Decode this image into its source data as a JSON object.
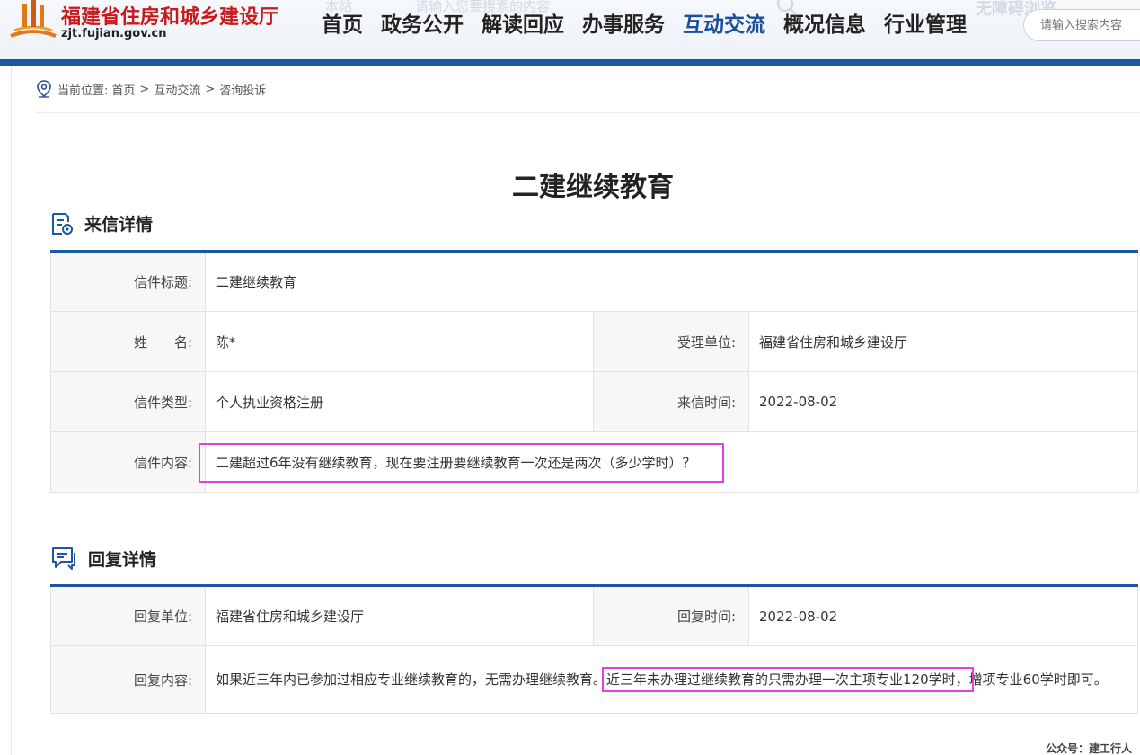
{
  "header": {
    "site_name": "福建省住房和城乡建设厅",
    "site_url": "zjt.fujian.gov.cn",
    "top_ghost_left": "本站",
    "top_ghost_placeholder": "请输入您要搜索的内容",
    "top_ghost_right": "无障碍浏览",
    "nav": [
      "首页",
      "政务公开",
      "解读回应",
      "办事服务",
      "互动交流",
      "概况信息",
      "行业管理"
    ],
    "active_nav": "互动交流",
    "search_placeholder": "请输入搜索内容"
  },
  "breadcrumb": {
    "prefix": "当前位置:",
    "items": [
      "首页",
      "互动交流",
      "咨询投诉"
    ],
    "separator": ">"
  },
  "page_title": "二建继续教育",
  "letter": {
    "heading": "来信详情",
    "title_label": "信件标题:",
    "title_value": "二建继续教育",
    "name_label": "姓　　名:",
    "name_value": "陈*",
    "dept_label": "受理单位:",
    "dept_value": "福建省住房和城乡建设厅",
    "type_label": "信件类型:",
    "type_value": "个人执业资格注册",
    "time_label": "来信时间:",
    "time_value": "2022-08-02",
    "content_label": "信件内容:",
    "content_value": "二建超过6年没有继续教育，现在要注册要继续教育一次还是两次（多少学时）？"
  },
  "reply": {
    "heading": "回复详情",
    "unit_label": "回复单位:",
    "unit_value": "福建省住房和城乡建设厅",
    "time_label": "回复时间:",
    "time_value": "2022-08-02",
    "content_label": "回复内容:",
    "content_part1": "如果近三年内已参加过相应专业继续教育的，无需办理继续教育。",
    "content_highlight": "近三年未办理过继续教育的只需办理一次主项专业120学时，",
    "content_part2": "增项专业60学时即可。"
  },
  "footer_note": "公众号：建工行人",
  "colors": {
    "brand_red": "#c8191e",
    "nav_active": "#1a4f9c",
    "blue_bar": "#1d56a5",
    "highlight": "#e43ee8"
  }
}
